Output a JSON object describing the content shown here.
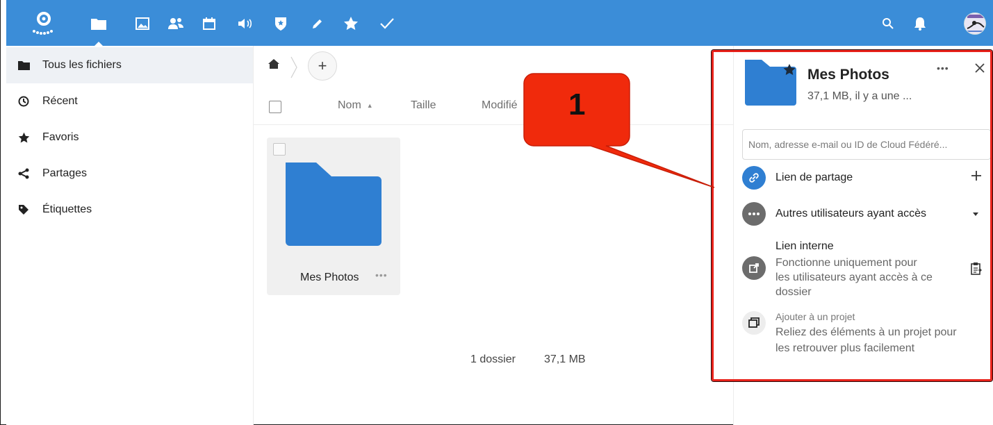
{
  "header": {
    "app_icons": [
      "files-icon",
      "photos-icon",
      "contacts-icon",
      "calendar-icon",
      "talk-icon",
      "passwords-icon",
      "notes-icon",
      "favorites-icon",
      "tasks-icon"
    ],
    "brand_color": "#3b8dd8"
  },
  "sidebar": {
    "items": [
      {
        "label": "Tous les fichiers",
        "icon": "folder-icon",
        "active": true
      },
      {
        "label": "Récent",
        "icon": "clock-icon"
      },
      {
        "label": "Favoris",
        "icon": "star-icon"
      },
      {
        "label": "Partages",
        "icon": "share-icon"
      },
      {
        "label": "Étiquettes",
        "icon": "tag-icon"
      }
    ]
  },
  "main": {
    "columns": {
      "name": "Nom",
      "size": "Taille",
      "modified": "Modifié"
    },
    "files": [
      {
        "name": "Mes Photos",
        "type": "folder"
      }
    ],
    "summary": {
      "folders": "1 dossier",
      "size": "37,1 MB"
    }
  },
  "panel": {
    "title": "Mes Photos",
    "subtitle": "37,1 MB, il y a une ...",
    "share_placeholder": "Nom, adresse e-mail ou ID de Cloud Fédéré...",
    "share_link_label": "Lien de partage",
    "others_label": "Autres utilisateurs ayant accès",
    "internal_link": {
      "title": "Lien interne",
      "line1": "Fonctionne uniquement pour",
      "line2": "les utilisateurs ayant accès à ce",
      "line3": "dossier"
    },
    "project": {
      "small": "Ajouter à un projet",
      "line1": "Reliez des éléments à un projet pour",
      "line2": "les retrouver plus facilement"
    },
    "highlight_color": "#e8221b"
  },
  "callout": {
    "number": "1",
    "color": "#f02a0c"
  }
}
